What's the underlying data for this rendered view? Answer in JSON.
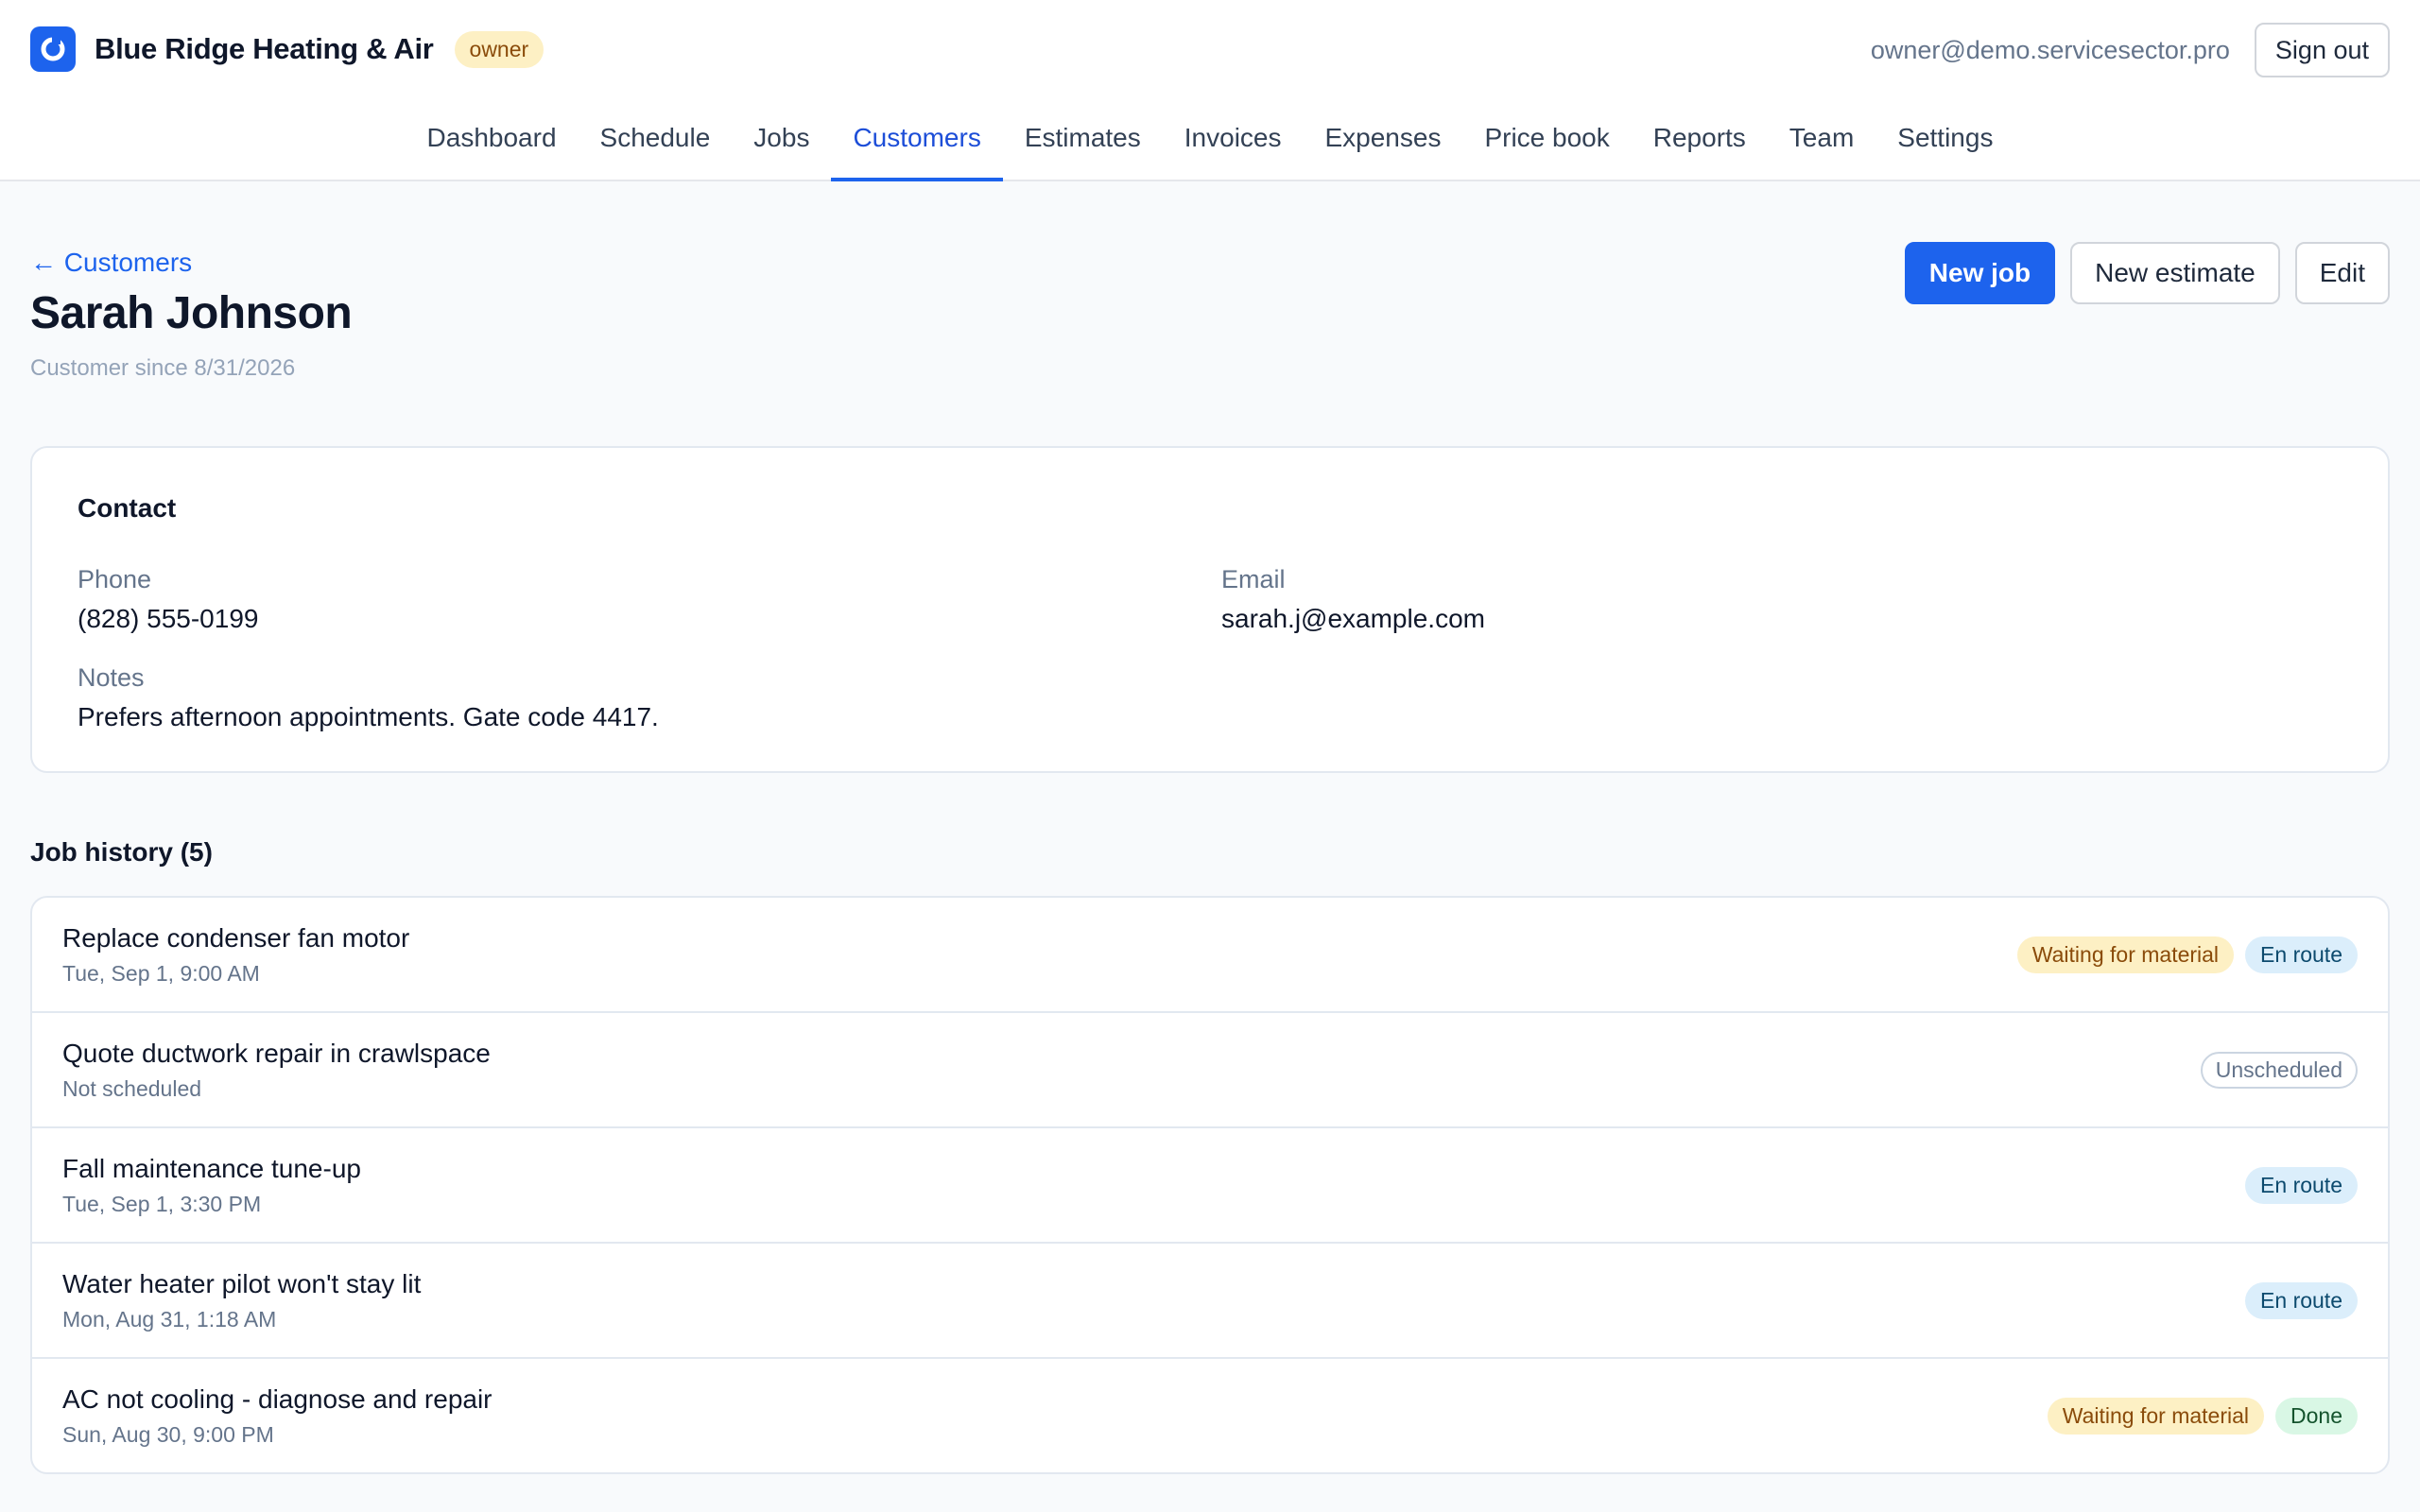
{
  "header": {
    "brand_name": "Blue Ridge Heating & Air",
    "role": "owner",
    "user_email": "owner@demo.servicesector.pro",
    "sign_out_label": "Sign out",
    "nav": [
      {
        "label": "Dashboard"
      },
      {
        "label": "Schedule"
      },
      {
        "label": "Jobs"
      },
      {
        "label": "Customers",
        "active": true
      },
      {
        "label": "Estimates"
      },
      {
        "label": "Invoices"
      },
      {
        "label": "Expenses"
      },
      {
        "label": "Price book"
      },
      {
        "label": "Reports"
      },
      {
        "label": "Team"
      },
      {
        "label": "Settings"
      }
    ]
  },
  "page": {
    "back_label": "← Customers",
    "title": "Sarah Johnson",
    "subtitle": "Customer since 8/31/2026",
    "actions": {
      "new_job": "New job",
      "new_estimate": "New estimate",
      "edit": "Edit"
    }
  },
  "contact": {
    "title": "Contact",
    "phone_label": "Phone",
    "phone": "(828) 555-0199",
    "email_label": "Email",
    "email": "sarah.j@example.com",
    "notes_label": "Notes",
    "notes": "Prefers afternoon appointments. Gate code 4417."
  },
  "job_history": {
    "title": "Job history (5)",
    "jobs": [
      {
        "title": "Replace condenser fan motor",
        "date": "Tue, Sep 1, 9:00 AM",
        "tags": [
          {
            "label": "Waiting for material",
            "kind": "waiting"
          },
          {
            "label": "En route",
            "kind": "enroute"
          }
        ]
      },
      {
        "title": "Quote ductwork repair in crawlspace",
        "date": "Not scheduled",
        "tags": [
          {
            "label": "Unscheduled",
            "kind": "unscheduled"
          }
        ]
      },
      {
        "title": "Fall maintenance tune-up",
        "date": "Tue, Sep 1, 3:30 PM",
        "tags": [
          {
            "label": "En route",
            "kind": "enroute"
          }
        ]
      },
      {
        "title": "Water heater pilot won't stay lit",
        "date": "Mon, Aug 31, 1:18 AM",
        "tags": [
          {
            "label": "En route",
            "kind": "enroute"
          }
        ]
      },
      {
        "title": "AC not cooling - diagnose and repair",
        "date": "Sun, Aug 30, 9:00 PM",
        "tags": [
          {
            "label": "Waiting for material",
            "kind": "waiting"
          },
          {
            "label": "Done",
            "kind": "done"
          }
        ]
      }
    ]
  },
  "colors": {
    "primary": "#1d63ed",
    "waiting": "#fdf0c4",
    "enroute": "#dbeefb",
    "done": "#d9f7e5"
  }
}
